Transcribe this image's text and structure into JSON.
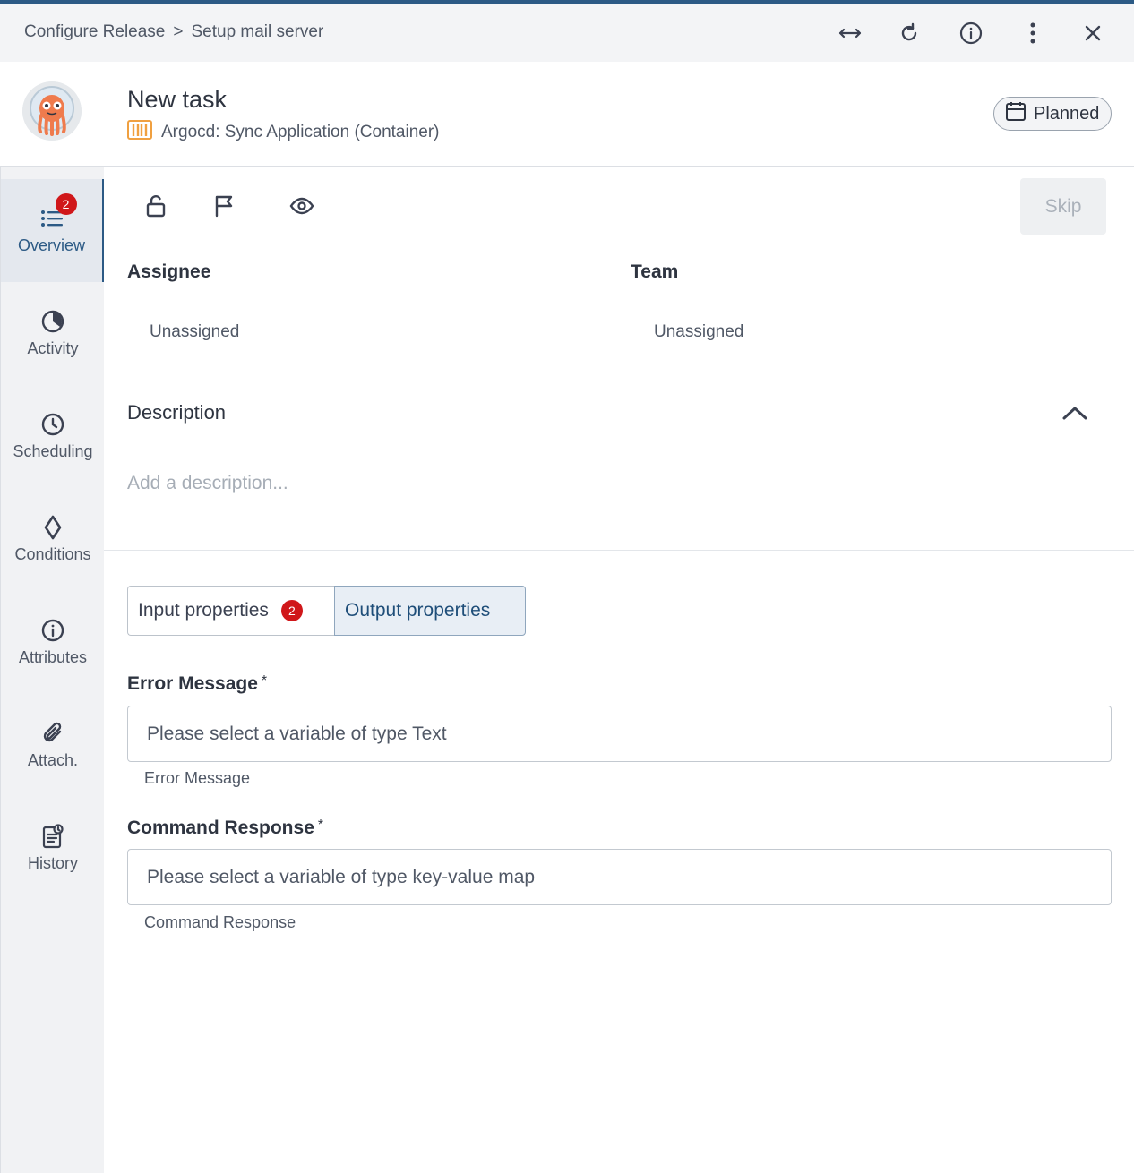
{
  "breadcrumb": {
    "parent": "Configure Release",
    "separator": ">",
    "current": "Setup mail server"
  },
  "titlebar_icons": [
    "expand-horizontal-icon",
    "refresh-icon",
    "info-icon",
    "more-vertical-icon",
    "close-icon"
  ],
  "task": {
    "title": "New task",
    "type_label": "Argocd: Sync Application (Container)",
    "status": "Planned"
  },
  "sidebar": {
    "items": [
      {
        "label": "Overview",
        "icon": "list-icon",
        "badge": "2",
        "active": true
      },
      {
        "label": "Activity",
        "icon": "activity-icon"
      },
      {
        "label": "Scheduling",
        "icon": "clock-icon"
      },
      {
        "label": "Conditions",
        "icon": "diamond-icon"
      },
      {
        "label": "Attributes",
        "icon": "info-icon"
      },
      {
        "label": "Attach.",
        "icon": "paperclip-icon"
      },
      {
        "label": "History",
        "icon": "history-icon"
      }
    ]
  },
  "toolbar": {
    "icons": [
      "lock-icon",
      "flag-icon",
      "eye-icon"
    ],
    "skip_label": "Skip"
  },
  "assignee": {
    "label": "Assignee",
    "value": "Unassigned"
  },
  "team": {
    "label": "Team",
    "value": "Unassigned"
  },
  "description": {
    "title": "Description",
    "placeholder": "Add a description..."
  },
  "properties_tabs": {
    "input_label": "Input properties",
    "input_badge": "2",
    "output_label": "Output properties",
    "active": "output"
  },
  "fields": [
    {
      "label": "Error Message",
      "required_mark": "*",
      "placeholder": "Please select a variable of type Text",
      "help": "Error Message"
    },
    {
      "label": "Command Response",
      "required_mark": "*",
      "placeholder": "Please select a variable of type key-value map",
      "help": "Command Response"
    }
  ],
  "colors": {
    "accent": "#2c5a85",
    "badge": "#d0171a",
    "sidebar_bg": "#f1f2f4"
  }
}
